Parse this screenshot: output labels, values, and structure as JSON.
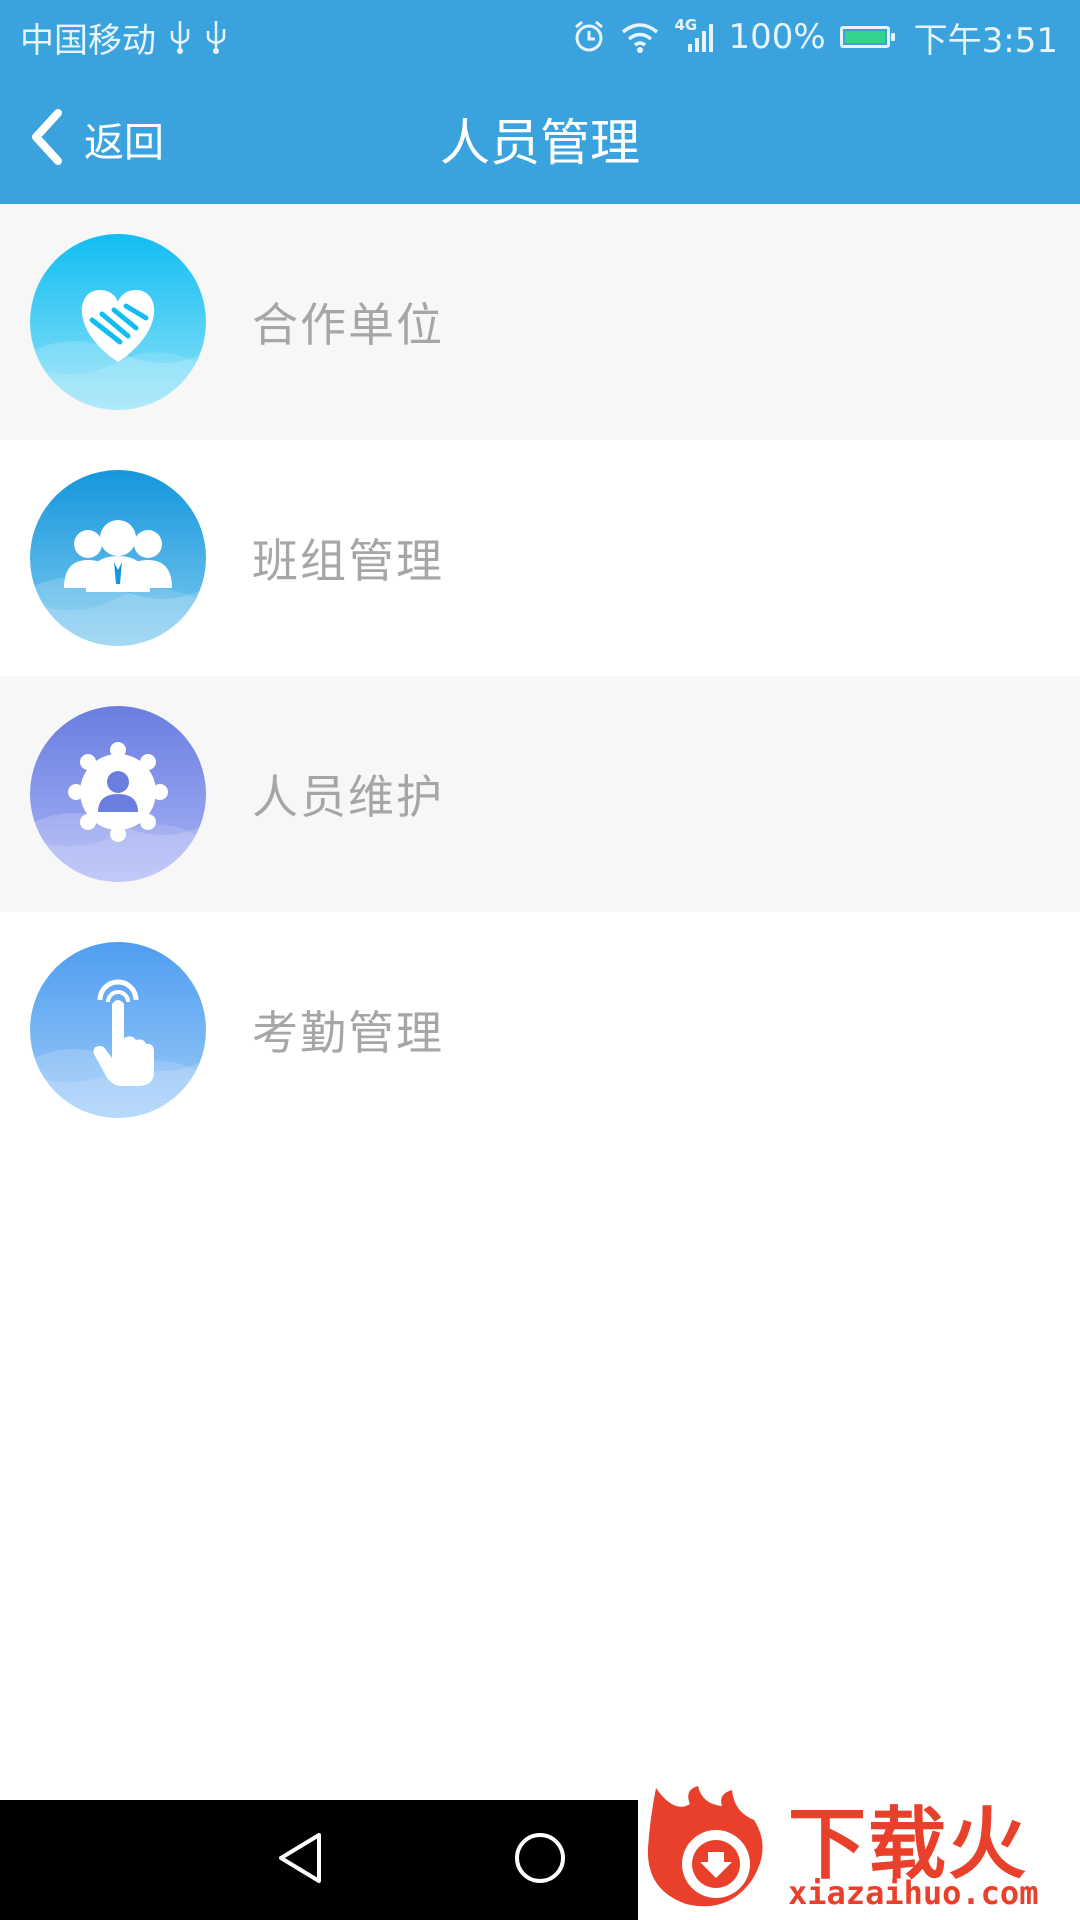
{
  "status_bar": {
    "carrier": "中国移动",
    "network": "4G",
    "battery": "100%",
    "time": "下午3:51",
    "icons": [
      "usb-icon",
      "usb-icon",
      "alarm-icon",
      "wifi-icon",
      "signal-icon",
      "battery-icon"
    ]
  },
  "header": {
    "back_label": "返回",
    "title": "人员管理"
  },
  "menu": {
    "items": [
      {
        "label": "合作单位",
        "icon": "handshake-icon",
        "colors": [
          "#12bdf2",
          "#8fe2f8"
        ]
      },
      {
        "label": "班组管理",
        "icon": "team-icon",
        "colors": [
          "#1597dc",
          "#7fcaf0"
        ]
      },
      {
        "label": "人员维护",
        "icon": "user-badge-icon",
        "colors": [
          "#6a7ee0",
          "#a8b3f6"
        ]
      },
      {
        "label": "考勤管理",
        "icon": "touch-icon",
        "colors": [
          "#4f9ef0",
          "#9ccaf8"
        ]
      }
    ]
  },
  "nav_bar": {
    "buttons": [
      "back-icon",
      "home-icon"
    ]
  },
  "watermark": {
    "title": "下载火",
    "url": "xiazaihuo.com"
  },
  "colors": {
    "header_bg": "#3aa3dd",
    "row_tint": "#f7f7f7",
    "label_text": "#a6a6a6",
    "watermark": "#e8402a"
  }
}
